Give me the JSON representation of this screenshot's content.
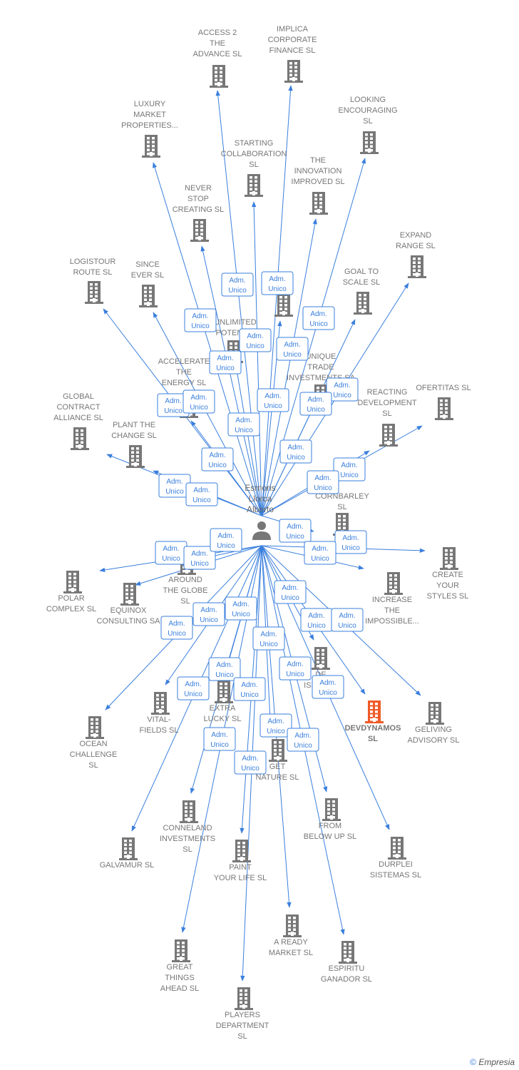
{
  "center": {
    "name_lines": [
      "Esmoris",
      "Llorca",
      "Alberto"
    ],
    "icon": "person-icon"
  },
  "edge_label": [
    "Adm.",
    "Unico"
  ],
  "colors": {
    "edge": "#3a7fdd",
    "company": "#777777",
    "highlight": "#f05a28"
  },
  "nodes": [
    {
      "lines": [
        "ACCESS 2",
        "THE",
        "ADVANCE  SL"
      ]
    },
    {
      "lines": [
        "IMPLICA",
        "CORPORATE",
        "FINANCE  SL"
      ]
    },
    {
      "lines": [
        "LUXURY",
        "MARKET",
        "PROPERTIES..."
      ]
    },
    {
      "lines": [
        "LOOKING",
        "ENCOURAGING",
        "SL"
      ]
    },
    {
      "lines": [
        "STARTING",
        "COLLABORATION",
        "SL"
      ]
    },
    {
      "lines": [
        "THE",
        "INNOVATION",
        "IMPROVED  SL"
      ]
    },
    {
      "lines": [
        "NEVER",
        "STOP",
        "CREATING  SL"
      ]
    },
    {
      "lines": [
        "EXPAND",
        "RANGE  SL"
      ]
    },
    {
      "lines": [
        "LOGISTOUR",
        "ROUTE  SL"
      ]
    },
    {
      "lines": [
        "SINCE",
        "EVER  SL"
      ]
    },
    {
      "lines": [
        "F     BE",
        "A"
      ]
    },
    {
      "lines": [
        "GOAL TO",
        "SCALE  SL"
      ]
    },
    {
      "lines": [
        "UNLIMITED",
        "POTENTIA"
      ]
    },
    {
      "lines": [
        "UNIQUE",
        "TRADE",
        "INVESTMENTS SA"
      ]
    },
    {
      "lines": [
        "ACCELERATE",
        "THE",
        "ENERGY  SL"
      ]
    },
    {
      "lines": [
        "GLOBAL",
        "CONTRACT",
        "ALLIANCE  SL"
      ]
    },
    {
      "lines": [
        "REACTING",
        "DEVELOPMENT",
        "SL"
      ]
    },
    {
      "lines": [
        "OFERTITAS  SL"
      ]
    },
    {
      "lines": [
        "PLANT THE",
        "CHANGE  SL"
      ]
    },
    {
      "lines": [
        "CORNBARLEY",
        "SL"
      ]
    },
    {
      "lines": [
        "CREATE",
        "YOUR",
        "STYLES  SL"
      ]
    },
    {
      "lines": [
        "POLAR",
        "COMPLEX  SL"
      ]
    },
    {
      "lines": [
        "AROUND",
        "THE GLOBE",
        "SL"
      ]
    },
    {
      "lines": [
        "EQUINOX",
        "CONSULTING SA"
      ]
    },
    {
      "lines": [
        "INCREASE",
        "THE",
        "IMPOSSIBLE..."
      ]
    },
    {
      "lines": [
        "DE",
        "ISLAS  SL"
      ]
    },
    {
      "lines": [
        "DEVDYNAMOS",
        "SL"
      ],
      "highlight": true
    },
    {
      "lines": [
        "GELIVING",
        "ADVISORY  SL"
      ]
    },
    {
      "lines": [
        "VITAL-",
        "FIELDS  SL"
      ]
    },
    {
      "lines": [
        "EXTRA",
        "LUCKY  SL"
      ]
    },
    {
      "lines": [
        "OCEAN",
        "CHALLENGE",
        "SL"
      ]
    },
    {
      "lines": [
        "GET",
        "NATURE  SL"
      ]
    },
    {
      "lines": [
        "CONNELAND",
        "INVESTMENTS",
        "SL"
      ]
    },
    {
      "lines": [
        "FROM",
        "BELOW UP  SL"
      ]
    },
    {
      "lines": [
        "GALVAMUR  SL"
      ]
    },
    {
      "lines": [
        "DURPLEI",
        "SISTEMAS  SL"
      ]
    },
    {
      "lines": [
        "PAINT",
        "YOUR LIFE  SL"
      ]
    },
    {
      "lines": [
        "A READY",
        "MARKET  SL"
      ]
    },
    {
      "lines": [
        "ESPIRITU",
        "GANADOR SL"
      ]
    },
    {
      "lines": [
        "GREAT",
        "THINGS",
        "AHEAD  SL"
      ]
    },
    {
      "lines": [
        "PLAYERS",
        "DEPARTMENT",
        "SL"
      ]
    }
  ],
  "footer": {
    "copyright": "©",
    "brand": "Empresia"
  }
}
